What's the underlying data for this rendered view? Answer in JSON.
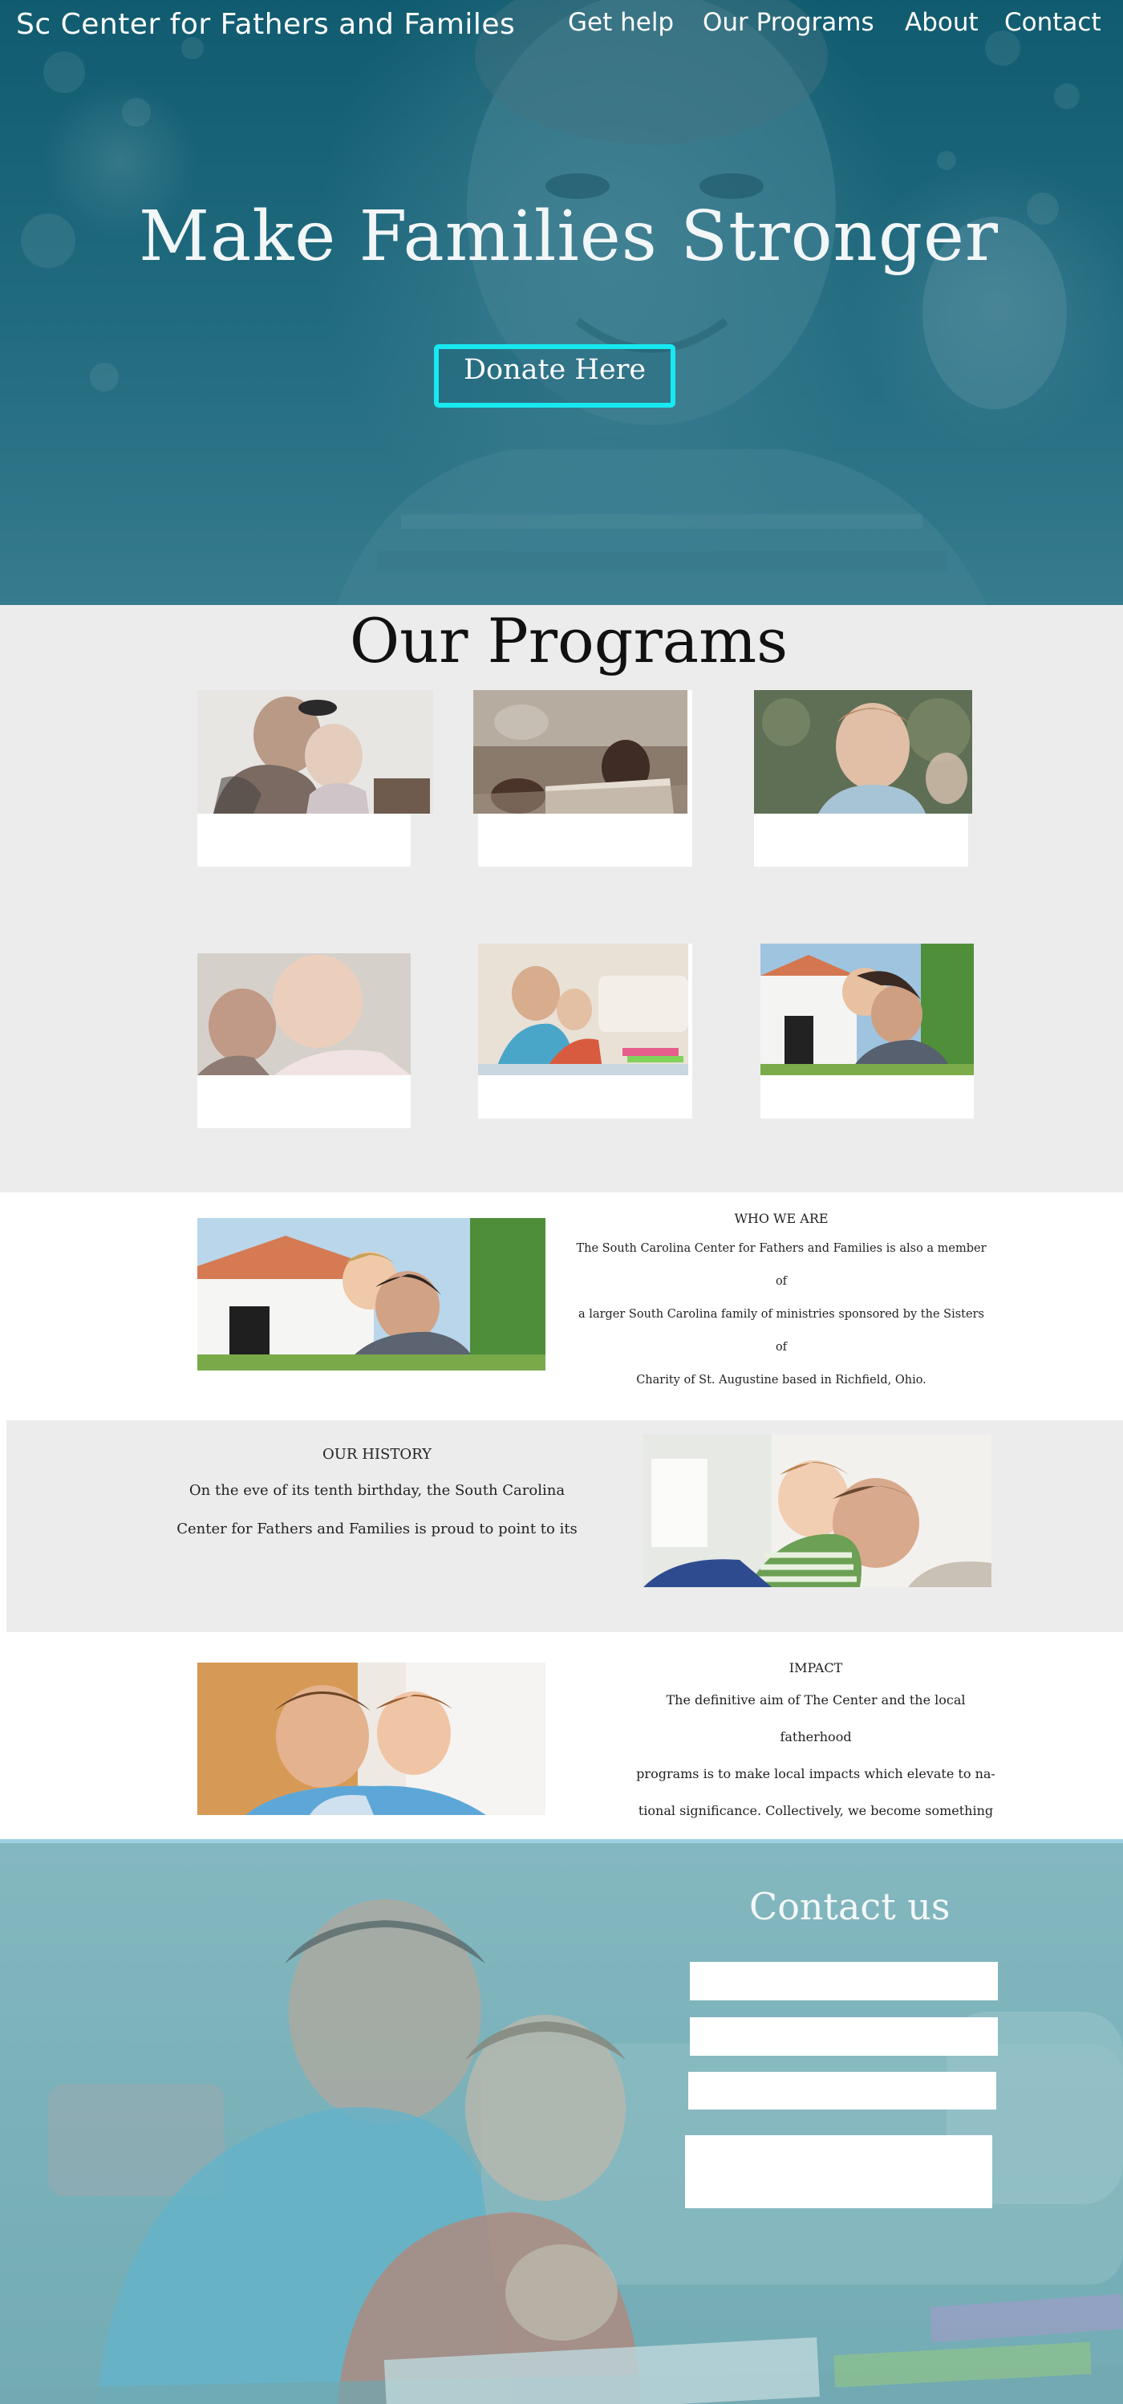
{
  "site": {
    "title": "Sc Center for Fathers and Familes"
  },
  "nav": {
    "items": [
      {
        "label": "Get help"
      },
      {
        "label": "Our Programs"
      },
      {
        "label": "About"
      },
      {
        "label": "Contact"
      }
    ]
  },
  "hero": {
    "heading": "Make Families Stronger",
    "donate_label": "Donate Here"
  },
  "programs": {
    "title": "Our Programs",
    "cards": [
      {
        "image": "father-and-baby-photo"
      },
      {
        "image": "father-and-son-reading-photo"
      },
      {
        "image": "smiling-boy-photo"
      },
      {
        "image": "grandfather-and-baby-photo"
      },
      {
        "image": "father-and-son-coloring-photo"
      },
      {
        "image": "father-carrying-son-photo"
      }
    ]
  },
  "who_we_are": {
    "heading": "WHO WE ARE",
    "lines": [
      "The South Carolina Center for Fathers and Families is also a member of",
      "a larger South Carolina family of ministries sponsored by the Sisters of",
      "Charity of St. Augustine based in Richfield, Ohio."
    ],
    "image": "father-carrying-son-photo"
  },
  "history": {
    "heading": "OUR HISTORY",
    "lines": [
      "On the eve of its tenth birthday, the South Carolina",
      "Center for Fathers and Families is proud to point to its"
    ],
    "image": "son-kissing-father-photo"
  },
  "impact": {
    "heading": "IMPACT",
    "lines": [
      "The definitive aim of The Center and the local fatherhood",
      "programs is to make local impacts which elevate to na-",
      "tional significance. Collectively, we become something"
    ],
    "image": "father-and-son-smiling-photo"
  },
  "contact": {
    "title": "Contact us",
    "fields": [
      {
        "value": "",
        "placeholder": ""
      },
      {
        "value": "",
        "placeholder": ""
      },
      {
        "value": "",
        "placeholder": ""
      },
      {
        "value": "",
        "placeholder": ""
      }
    ]
  },
  "colors": {
    "hero_overlay": "#145f73",
    "donate_border": "#18e9f0",
    "programs_bg": "#ececec",
    "history_bg": "#ececec",
    "contact_overlay": "#7cb2bb",
    "contact_divider": "#9fd0e2"
  }
}
